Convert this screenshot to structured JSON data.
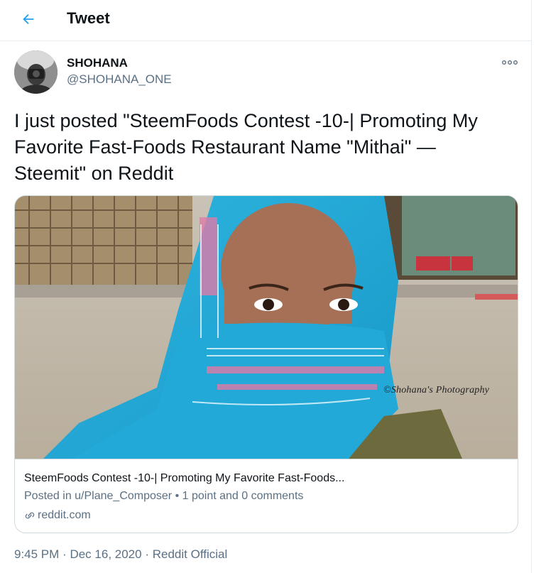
{
  "header": {
    "title": "Tweet",
    "back_icon": "arrow-left-icon"
  },
  "author": {
    "display_name": "SHOHANA",
    "handle": "@SHOHANA_ONE"
  },
  "tweet": {
    "text": "I just posted \"SteemFoods Contest -10-| Promoting My\nFavorite Fast-Foods Restaurant Name \"Mithai\" —\nSteemit\" on Reddit"
  },
  "card": {
    "image_watermark": "©Shohana's Photography",
    "title": "SteemFoods Contest -10-| Promoting My Favorite Fast-Foods...",
    "description": "Posted in u/Plane_Composer • 1 point and 0 comments",
    "domain": "reddit.com"
  },
  "meta": {
    "time": "9:45 PM",
    "separator": "·",
    "date": "Dec 16, 2020",
    "source": "Reddit Official"
  },
  "colors": {
    "accent": "#1da1f2",
    "secondary_text": "#5b7083",
    "border": "#cfd9de"
  }
}
